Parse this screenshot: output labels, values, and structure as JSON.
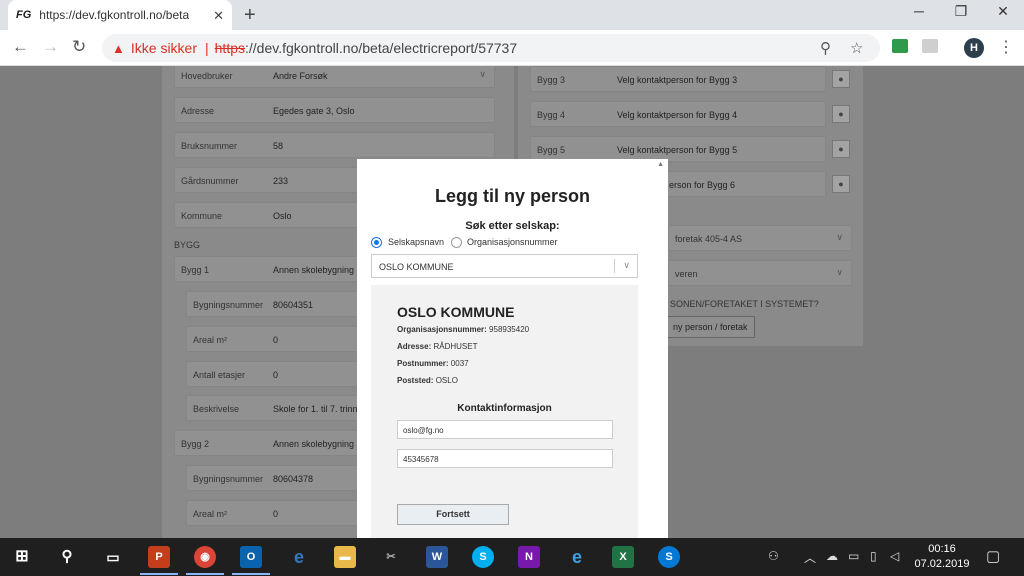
{
  "browser": {
    "tab_title": "https://dev.fgkontroll.no/beta/elec",
    "tab_favicon": "FG",
    "new_tab": "+",
    "security_label": "Ikke sikker",
    "url_scheme": "https",
    "url_rest": "://dev.fgkontroll.no/beta/electricreport/57737",
    "profile_initial": "H"
  },
  "background_form": {
    "left_rows": [
      {
        "label": "Hovedbruker",
        "value": "Andre Forsøk"
      },
      {
        "label": "Adresse",
        "value": "Egedes gate 3, Oslo"
      },
      {
        "label": "Bruksnummer",
        "value": "58"
      },
      {
        "label": "Gårdsnummer",
        "value": "233"
      },
      {
        "label": "Kommune",
        "value": "Oslo"
      }
    ],
    "bygg_heading": "BYGG",
    "bygg1": {
      "label": "Bygg 1",
      "value": "Annen skolebygning"
    },
    "bygg1_rows": [
      {
        "label": "Bygningsnummer",
        "value": "80604351"
      },
      {
        "label": "Areal m²",
        "value": "0"
      },
      {
        "label": "Antall etasjer",
        "value": "0"
      },
      {
        "label": "Beskrivelse",
        "value": "Skole for 1. til 7. trinn"
      }
    ],
    "bygg2": {
      "label": "Bygg 2",
      "value": "Annen skolebygning"
    },
    "bygg2_rows": [
      {
        "label": "Bygningsnummer",
        "value": "80604378"
      },
      {
        "label": "Areal m²",
        "value": "0"
      }
    ],
    "right_rows": [
      {
        "label": "Bygg 3",
        "value": "Velg kontaktperson for Bygg 3"
      },
      {
        "label": "Bygg 4",
        "value": "Velg kontaktperson for Bygg 4"
      },
      {
        "label": "Bygg 5",
        "value": "Velg kontaktperson for Bygg 5"
      },
      {
        "label": "",
        "value": "erson for Bygg 6"
      }
    ],
    "right_select1": "foretak 405-4 AS",
    "right_select2": "veren",
    "right_question": "SONEN/FORETAKET I SYSTEMET?",
    "right_button": "ny person / foretak"
  },
  "modal": {
    "title": "Legg til ny person",
    "search_label": "Søk etter selskap:",
    "radio_company": "Selskapsnavn",
    "radio_orgnr": "Organisasjonsnummer",
    "selected_company": "OSLO KOMMUNE",
    "org_name": "OSLO KOMMUNE",
    "orgnr_label": "Organisasjonsnummer:",
    "orgnr_value": "958935420",
    "address_label": "Adresse:",
    "address_value": "RÅDHUSET",
    "postnr_label": "Postnummer:",
    "postnr_value": "0037",
    "poststed_label": "Poststed:",
    "poststed_value": "OSLO",
    "contact_heading": "Kontaktinformasjon",
    "email_value": "oslo@fg.no",
    "phone_value": "45345678",
    "continue_label": "Fortsett"
  },
  "taskbar": {
    "time": "00:16",
    "date": "07.02.2019"
  }
}
